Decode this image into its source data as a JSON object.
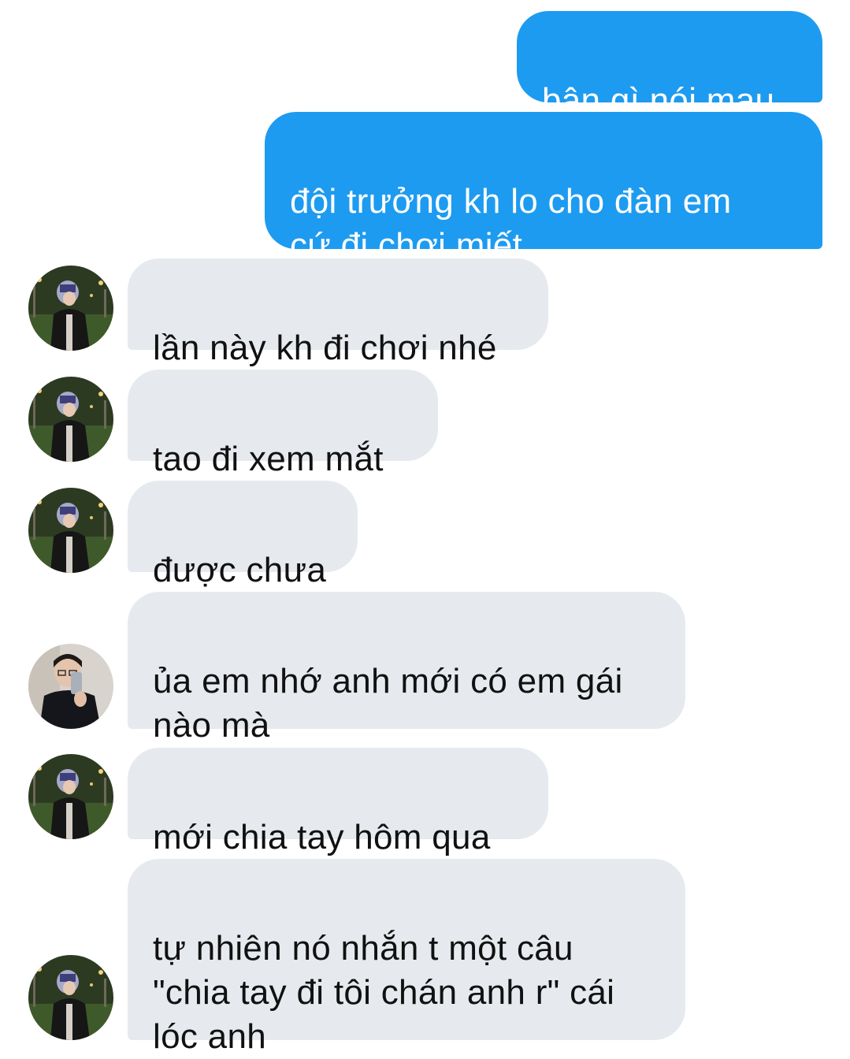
{
  "conversation": {
    "messages": [
      {
        "direction": "outgoing",
        "sender": "me",
        "text": "bận gì nói mau"
      },
      {
        "direction": "outgoing",
        "sender": "me",
        "text": "đội trưởng kh lo cho đàn em\ncứ đi chơi miết"
      },
      {
        "direction": "incoming",
        "sender": "person-a",
        "text": "lần này kh đi chơi nhé"
      },
      {
        "direction": "incoming",
        "sender": "person-a",
        "text": "tao đi xem mắt"
      },
      {
        "direction": "incoming",
        "sender": "person-a",
        "text": "được chưa"
      },
      {
        "direction": "incoming",
        "sender": "person-b",
        "text": "ủa em nhớ anh mới có em gái\nnào mà"
      },
      {
        "direction": "incoming",
        "sender": "person-a",
        "text": "mới chia tay hôm qua"
      },
      {
        "direction": "incoming",
        "sender": "person-a",
        "text": "tự nhiên nó nhắn t một câu\n\"chia tay đi tôi chán anh r\" cái\nlóc anh"
      }
    ]
  },
  "colors": {
    "outgoing_bubble": "#1d9bf0",
    "incoming_bubble": "#e6eaee",
    "outgoing_text": "#ffffff",
    "incoming_text": "#111111",
    "background": "#ffffff"
  }
}
